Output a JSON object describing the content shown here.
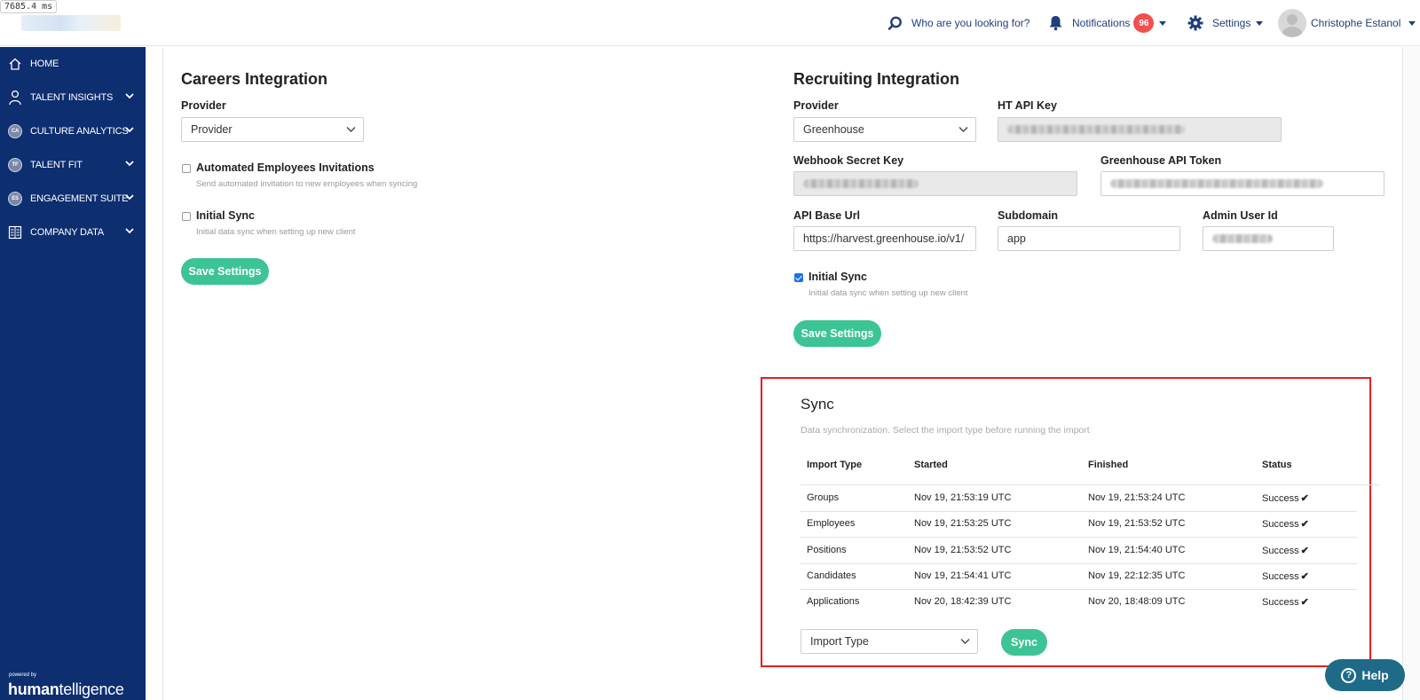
{
  "perf_label": "7685.4 ms",
  "header": {
    "search_label": "Who are you looking for?",
    "notifications_label": "Notifications",
    "notifications_count": "96",
    "settings_label": "Settings",
    "user_name": "Christophe Estanol"
  },
  "sidebar": {
    "items": [
      {
        "label": "HOME",
        "icon": "home-icon"
      },
      {
        "label": "TALENT INSIGHTS",
        "icon": "person-icon"
      },
      {
        "label": "CULTURE ANALYTICS",
        "icon": "ca-icon",
        "abbr": "CA"
      },
      {
        "label": "TALENT FIT",
        "icon": "tf-icon",
        "abbr": "TF"
      },
      {
        "label": "ENGAGEMENT SUITE",
        "icon": "es-icon",
        "abbr": "ES"
      },
      {
        "label": "COMPANY DATA",
        "icon": "building-icon"
      }
    ],
    "powered_by": "powered by",
    "brand_bold": "human",
    "brand_rest": "telligence"
  },
  "careers": {
    "title": "Careers Integration",
    "provider_label": "Provider",
    "provider_value": "Provider",
    "auto_invite_label": "Automated Employees Invitations",
    "auto_invite_desc": "Send automated invitation to new employees when syncing",
    "initial_sync_label": "Initial Sync",
    "initial_sync_desc": "Initial data sync when setting up new client",
    "save_label": "Save Settings"
  },
  "recruiting": {
    "title": "Recruiting Integration",
    "provider_label": "Provider",
    "provider_value": "Greenhouse",
    "ht_api_key_label": "HT API Key",
    "webhook_label": "Webhook Secret Key",
    "gh_token_label": "Greenhouse API Token",
    "api_base_label": "API Base Url",
    "api_base_value": "https://harvest.greenhouse.io/v1/",
    "subdomain_label": "Subdomain",
    "subdomain_value": "app",
    "admin_user_label": "Admin User Id",
    "initial_sync_label": "Initial Sync",
    "initial_sync_desc": "Initial data sync when setting up new client",
    "save_label": "Save Settings"
  },
  "sync": {
    "title": "Sync",
    "description": "Data synchronization. Select the import type before running the import",
    "columns": [
      "Import Type",
      "Started",
      "Finished",
      "Status"
    ],
    "rows": [
      {
        "type": "Groups",
        "started": "Nov 19, 21:53:19 UTC",
        "finished": "Nov 19, 21:53:24 UTC",
        "status": "Success"
      },
      {
        "type": "Employees",
        "started": "Nov 19, 21:53:25 UTC",
        "finished": "Nov 19, 21:53:52 UTC",
        "status": "Success"
      },
      {
        "type": "Positions",
        "started": "Nov 19, 21:53:52 UTC",
        "finished": "Nov 19, 21:54:40 UTC",
        "status": "Success"
      },
      {
        "type": "Candidates",
        "started": "Nov 19, 21:54:41 UTC",
        "finished": "Nov 19, 22:12:35 UTC",
        "status": "Success"
      },
      {
        "type": "Applications",
        "started": "Nov 20, 18:42:39 UTC",
        "finished": "Nov 20, 18:48:09 UTC",
        "status": "Success"
      }
    ],
    "import_type_placeholder": "Import Type",
    "sync_button": "Sync"
  },
  "help_label": "Help",
  "colors": {
    "sidebar": "#0d2e6f",
    "accent": "#3cc495",
    "link": "#1f3f7a",
    "badge": "#f0504f",
    "highlight": "#e32020"
  }
}
